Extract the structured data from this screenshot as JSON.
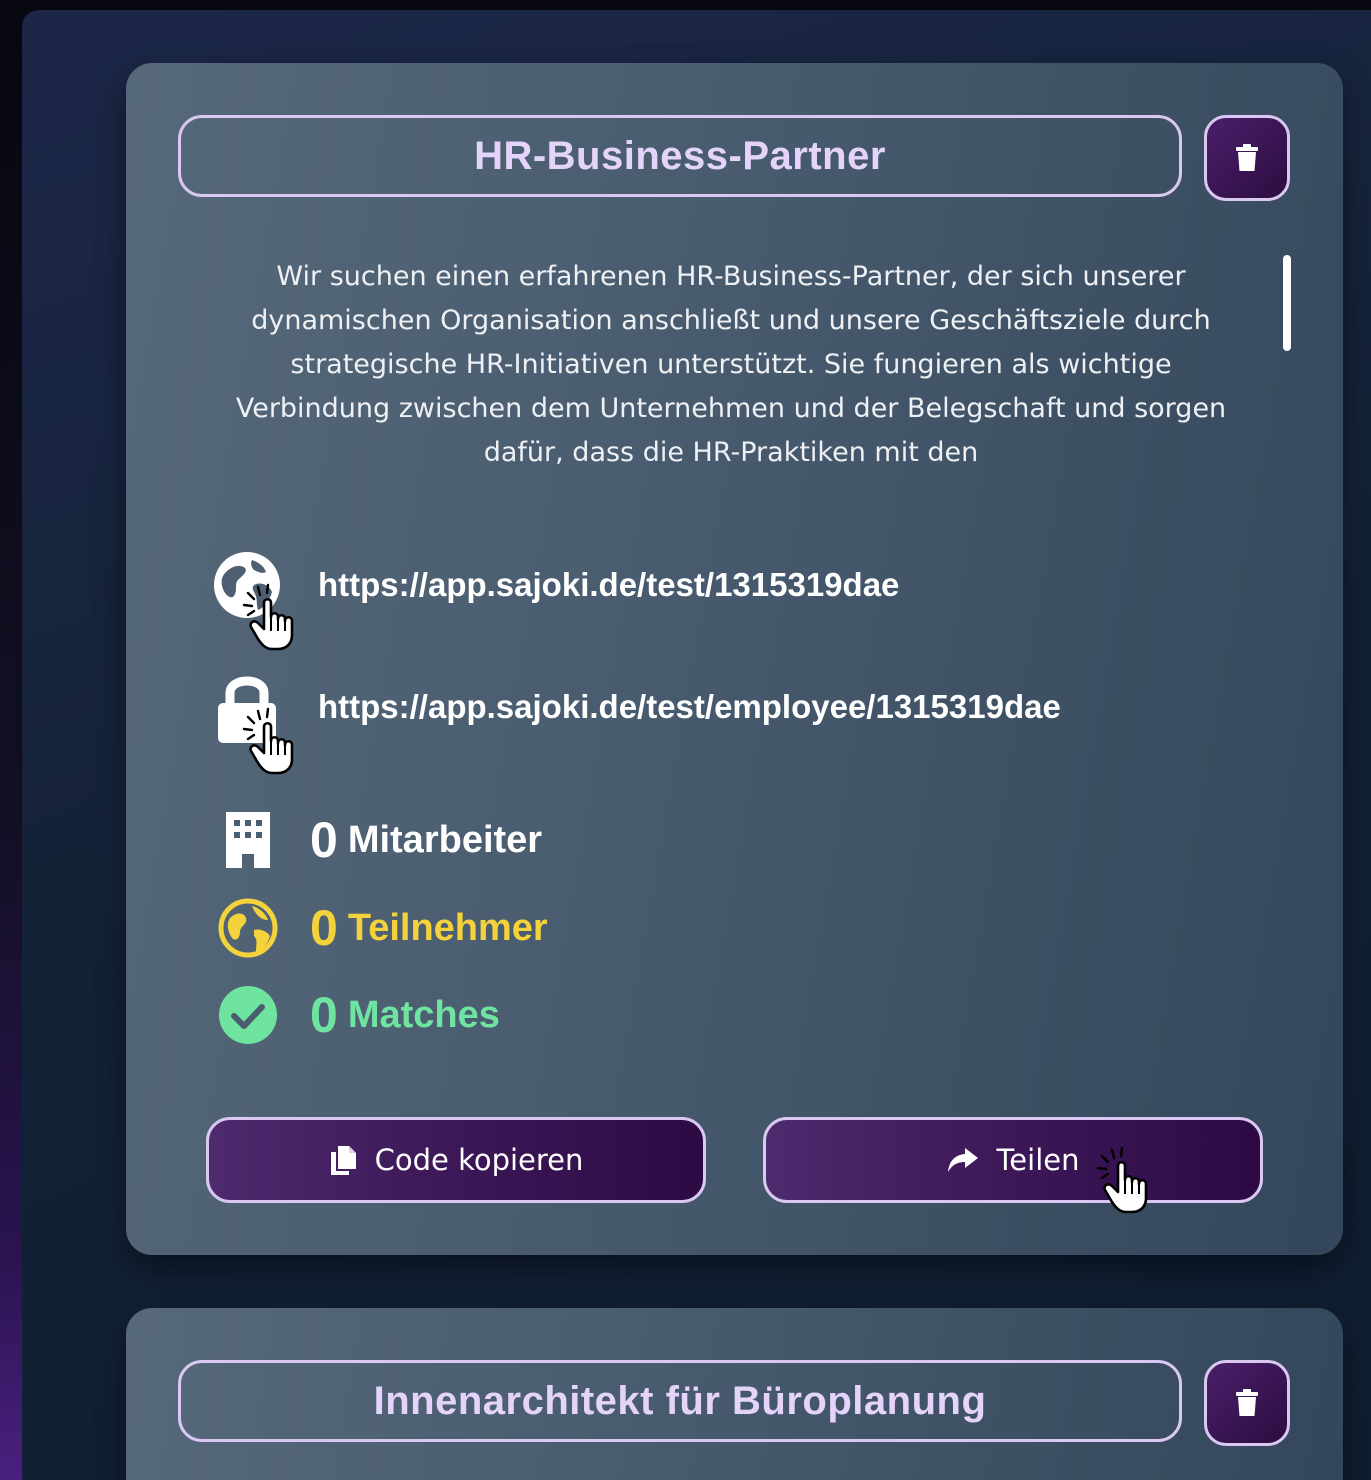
{
  "cards": [
    {
      "title": "HR-Business-Partner",
      "description": "Wir suchen einen erfahrenen HR-Business-Partner, der sich unserer dynamischen Organisation anschließt und unsere Geschäftsziele durch strategische HR-Initiativen unterstützt. Sie fungieren als wichtige Verbindung zwischen dem Unternehmen und der Belegschaft und sorgen dafür, dass die HR-Praktiken mit den",
      "public_link": "https://app.sajoki.de/test/1315319dae",
      "employee_link": "https://app.sajoki.de/test/employee/1315319dae",
      "stats": {
        "employees": {
          "count": "0",
          "label": "Mitarbeiter"
        },
        "participants": {
          "count": "0",
          "label": "Teilnehmer"
        },
        "matches": {
          "count": "0",
          "label": "Matches"
        }
      },
      "copy_label": "Code kopieren",
      "share_label": "Teilen"
    },
    {
      "title": "Innenarchitekt für Büroplanung"
    }
  ],
  "colors": {
    "accent_border": "#d9c8f2",
    "button_purple": "#3a1656",
    "participants_yellow": "#f4d23c",
    "matches_green": "#6fe3a0"
  },
  "icons": {
    "delete": "trash-icon",
    "public_link": "globe-icon",
    "employee_link": "lock-icon",
    "employees": "building-icon",
    "participants": "globe-filled-icon",
    "matches": "check-circle-icon",
    "copy": "copy-icon",
    "share": "share-icon",
    "cursor": "hand-pointer-icon"
  }
}
